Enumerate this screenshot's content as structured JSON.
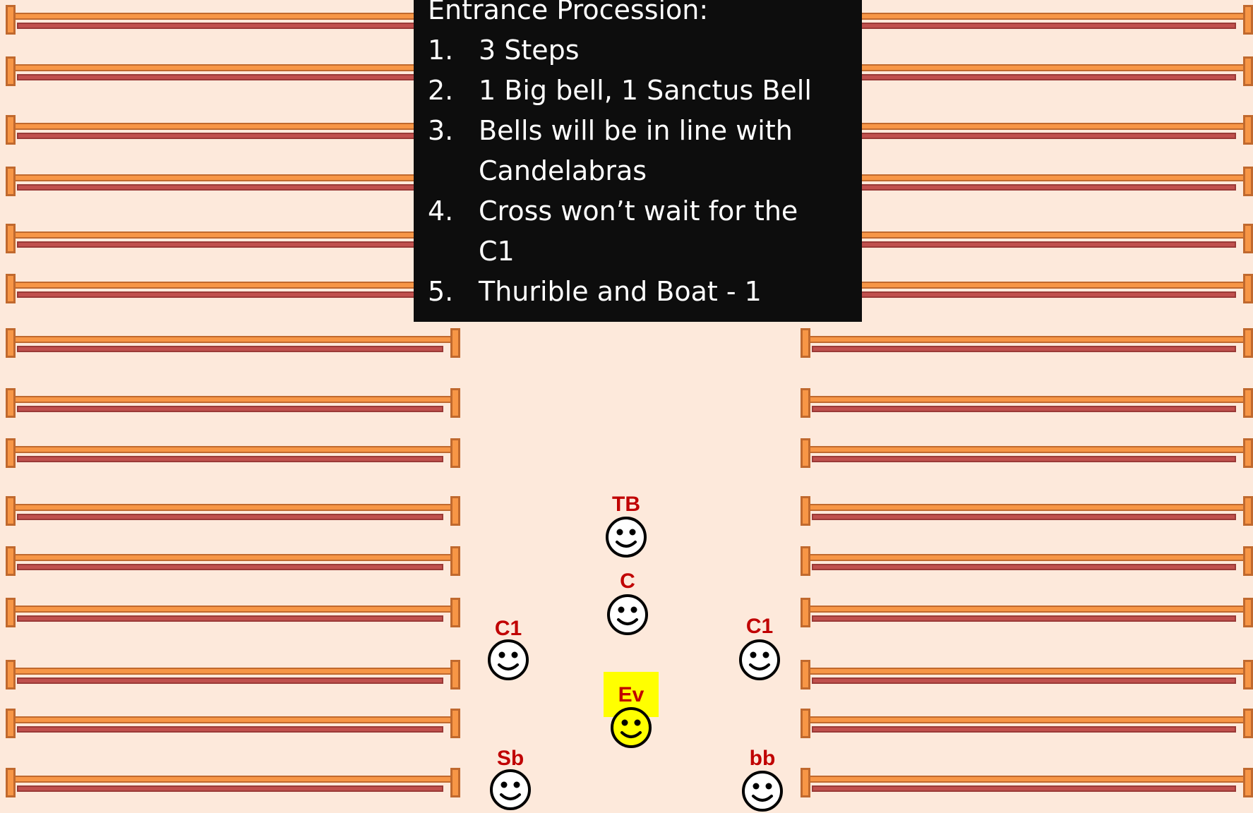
{
  "notes": {
    "title": "Entrance Procession:",
    "items": [
      {
        "num": "1.",
        "lines": [
          "3 Steps"
        ]
      },
      {
        "num": "2.",
        "lines": [
          "1 Big bell, 1 Sanctus Bell"
        ]
      },
      {
        "num": "3.",
        "lines": [
          "Bells will be in line with",
          "Candelabras"
        ]
      },
      {
        "num": "4.",
        "lines": [
          "Cross won’t wait for the",
          "C1"
        ]
      },
      {
        "num": "5.",
        "lines": [
          "Thurible and Boat - 1"
        ]
      }
    ]
  },
  "people": [
    {
      "id": "tb",
      "label": "TB",
      "highlight": false
    },
    {
      "id": "c",
      "label": "C",
      "highlight": false
    },
    {
      "id": "c1-left",
      "label": "C1",
      "highlight": false
    },
    {
      "id": "c1-right",
      "label": "C1",
      "highlight": false
    },
    {
      "id": "ev",
      "label": "Ev",
      "highlight": true
    },
    {
      "id": "sb",
      "label": "Sb",
      "highlight": false
    },
    {
      "id": "bb",
      "label": "bb",
      "highlight": false
    }
  ],
  "colors": {
    "background": "#fde9db",
    "pew": "#f79646",
    "pew_shadow": "#c0504d",
    "label": "#c00000",
    "highlight": "#ffff00",
    "notes_bg": "#0d0d0d"
  },
  "icons": {
    "person": "smiley-face-icon",
    "pew": "pew-bench-icon"
  }
}
